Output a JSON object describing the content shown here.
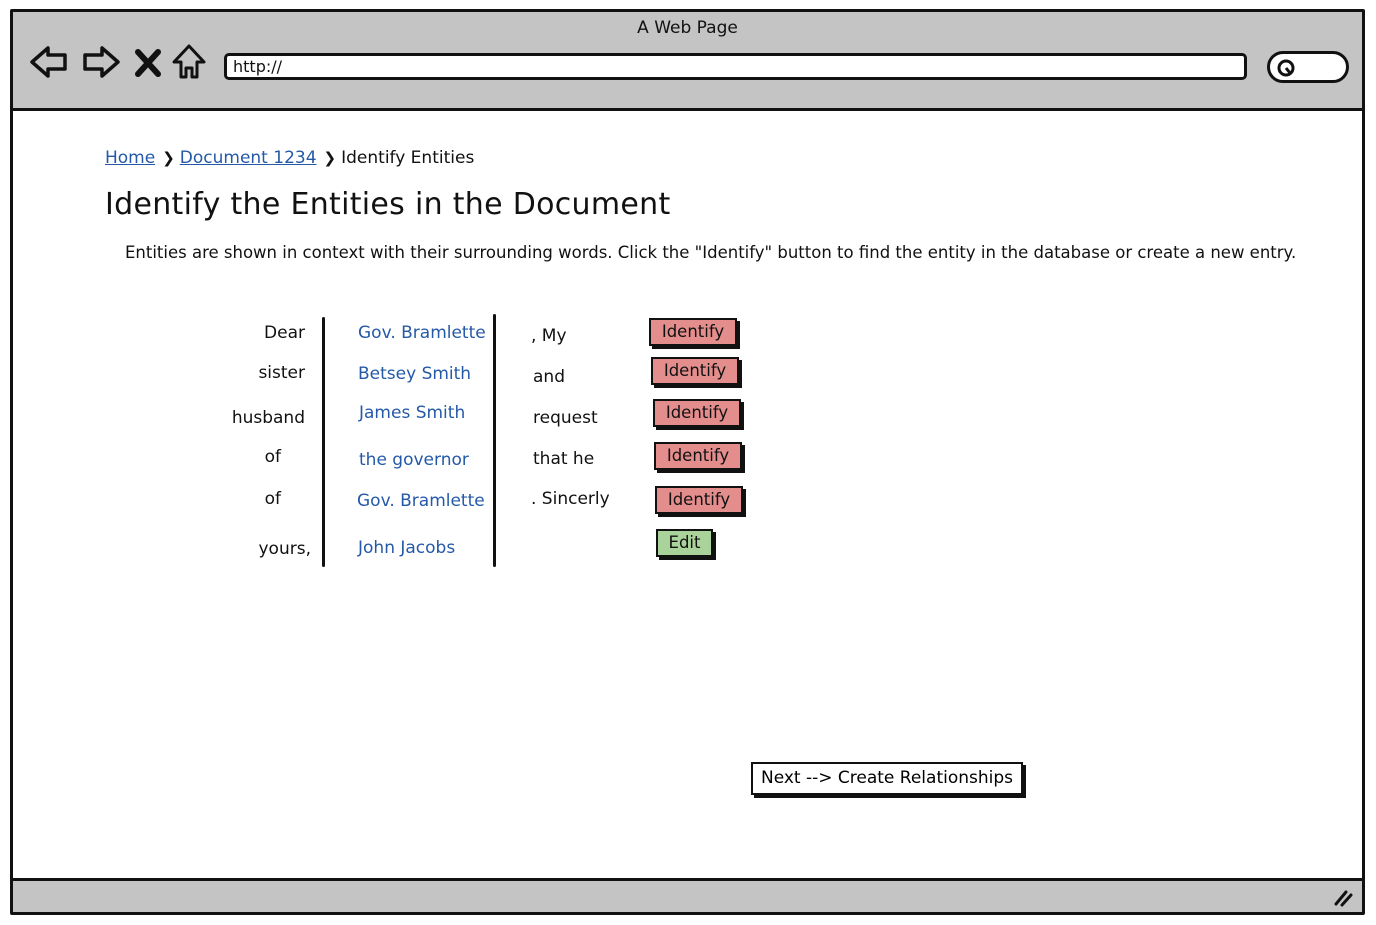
{
  "window": {
    "title": "A Web Page"
  },
  "browser": {
    "url": "http://"
  },
  "breadcrumb": {
    "items": [
      "Home",
      "Document 1234"
    ],
    "current": "Identify Entities"
  },
  "page": {
    "title": "Identify the Entities in the Document",
    "description": "Entities are shown in context with their surrounding words.  Click the \"Identify\" button to find the entity in the database or create a new entry."
  },
  "entities": [
    {
      "before": "Dear",
      "entity": "Gov. Bramlette",
      "after": ", My",
      "action": "Identify"
    },
    {
      "before": "sister",
      "entity": "Betsey Smith",
      "after": "and",
      "action": "Identify"
    },
    {
      "before": "husband",
      "entity": "James Smith",
      "after": "request",
      "action": "Identify"
    },
    {
      "before": "of",
      "entity": "the governor",
      "after": "that he",
      "action": "Identify"
    },
    {
      "before": "of",
      "entity": "Gov. Bramlette",
      "after": ".  Sincerly",
      "action": "Identify"
    },
    {
      "before": "yours,",
      "entity": "John Jacobs",
      "after": "",
      "action": "Edit"
    }
  ],
  "next_button": {
    "label": "Next --> Create Relationships"
  },
  "colors": {
    "identify_button": "#e48d8d",
    "edit_button": "#a9d39a",
    "link": "#2459a8",
    "chrome": "#c4c4c4"
  }
}
